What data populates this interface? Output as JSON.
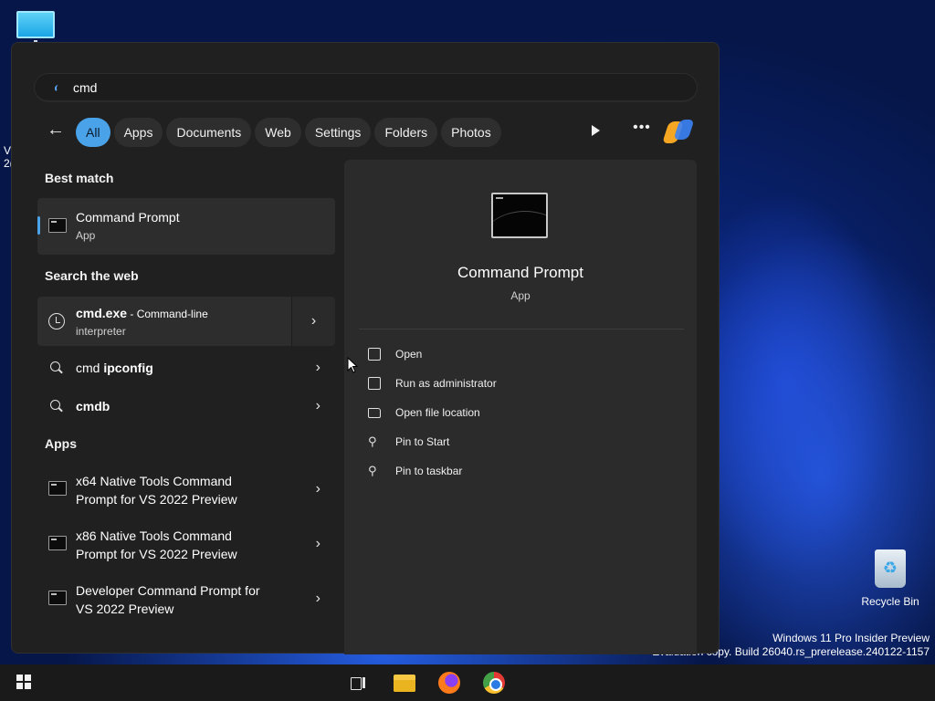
{
  "desktop": {
    "edge_text_line1": "V",
    "edge_text_line2": "2(",
    "recycle_bin_label": "Recycle Bin",
    "watermark_line1": "Windows 11 Pro Insider Preview",
    "watermark_line2": "Evaluation copy. Build 26040.rs_prerelease.240122-1157"
  },
  "search": {
    "query": "cmd",
    "filters": [
      "All",
      "Apps",
      "Documents",
      "Web",
      "Settings",
      "Folders",
      "Photos"
    ],
    "active_filter": "All"
  },
  "results": {
    "best_match_title": "Best match",
    "best_match": {
      "title": "Command Prompt",
      "subtitle": "App"
    },
    "web_title": "Search the web",
    "web_main": {
      "title_bold": "cmd.exe",
      "title_rest": " - Command-line",
      "subtitle": "interpreter"
    },
    "web_items": [
      {
        "prefix": "cmd ",
        "bold": "ipconfig"
      },
      {
        "prefix": "",
        "bold": "cmdb"
      }
    ],
    "apps_title": "Apps",
    "apps": [
      {
        "line1": "x64 Native Tools Command",
        "line2": "Prompt for VS 2022 Preview"
      },
      {
        "line1": "x86 Native Tools Command",
        "line2": "Prompt for VS 2022 Preview"
      },
      {
        "line1": "Developer Command Prompt for",
        "line2": "VS 2022 Preview"
      }
    ]
  },
  "preview": {
    "title": "Command Prompt",
    "subtitle": "App",
    "actions": [
      {
        "label": "Open",
        "icon": "open-external-icon"
      },
      {
        "label": "Run as administrator",
        "icon": "shield-admin-icon"
      },
      {
        "label": "Open file location",
        "icon": "folder-icon"
      },
      {
        "label": "Pin to Start",
        "icon": "pin-icon"
      },
      {
        "label": "Pin to taskbar",
        "icon": "pin-icon"
      }
    ]
  },
  "colors": {
    "accent": "#4aa3e8",
    "panel_bg": "#202020",
    "preview_bg": "#2b2b2b"
  }
}
